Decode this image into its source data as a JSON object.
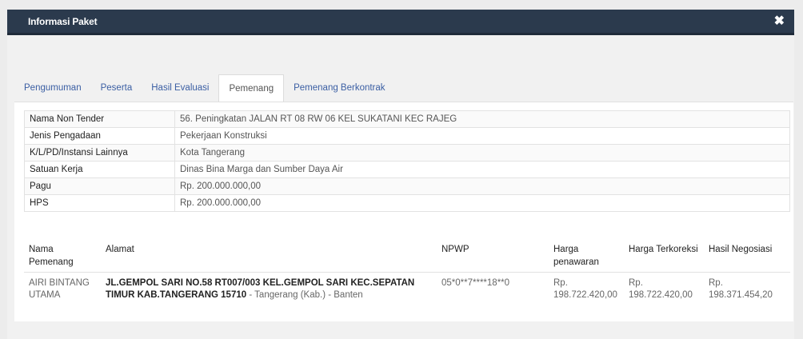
{
  "modal": {
    "title": "Informasi Paket"
  },
  "tabs": [
    {
      "label": "Pengumuman"
    },
    {
      "label": "Peserta"
    },
    {
      "label": "Hasil Evaluasi"
    },
    {
      "label": "Pemenang"
    },
    {
      "label": "Pemenang Berkontrak"
    }
  ],
  "active_tab": "Pemenang",
  "info": [
    {
      "label": "Nama Non Tender",
      "value": "56. Peningkatan JALAN RT 08 RW 06 KEL SUKATANI KEC RAJEG"
    },
    {
      "label": "Jenis Pengadaan",
      "value": "Pekerjaan Konstruksi"
    },
    {
      "label": "K/L/PD/Instansi Lainnya",
      "value": "Kota Tangerang"
    },
    {
      "label": "Satuan Kerja",
      "value": "Dinas Bina Marga dan Sumber Daya Air"
    },
    {
      "label": "Pagu",
      "value": "Rp. 200.000.000,00"
    },
    {
      "label": "HPS",
      "value": "Rp. 200.000.000,00"
    }
  ],
  "winner_table": {
    "headers": {
      "nama": "Nama Pemenang",
      "alamat": "Alamat",
      "npwp": "NPWP",
      "harga_penawaran": "Harga penawaran",
      "harga_terkoreksi": "Harga Terkoreksi",
      "hasil_negosiasi": "Hasil Negosiasi"
    },
    "rows": [
      {
        "nama": "AIRI BINTANG UTAMA",
        "alamat_bold": "JL.GEMPOL SARI NO.58 RT007/003 KEL.GEMPOL SARI KEC.SEPATAN TIMUR KAB.TANGERANG 15710",
        "alamat_rest": " - Tangerang (Kab.) - Banten",
        "npwp": "05*0**7****18**0",
        "harga_penawaran": "Rp. 198.722.420,00",
        "harga_terkoreksi": "Rp. 198.722.420,00",
        "hasil_negosiasi": "Rp. 198.371.454,20"
      }
    ]
  }
}
